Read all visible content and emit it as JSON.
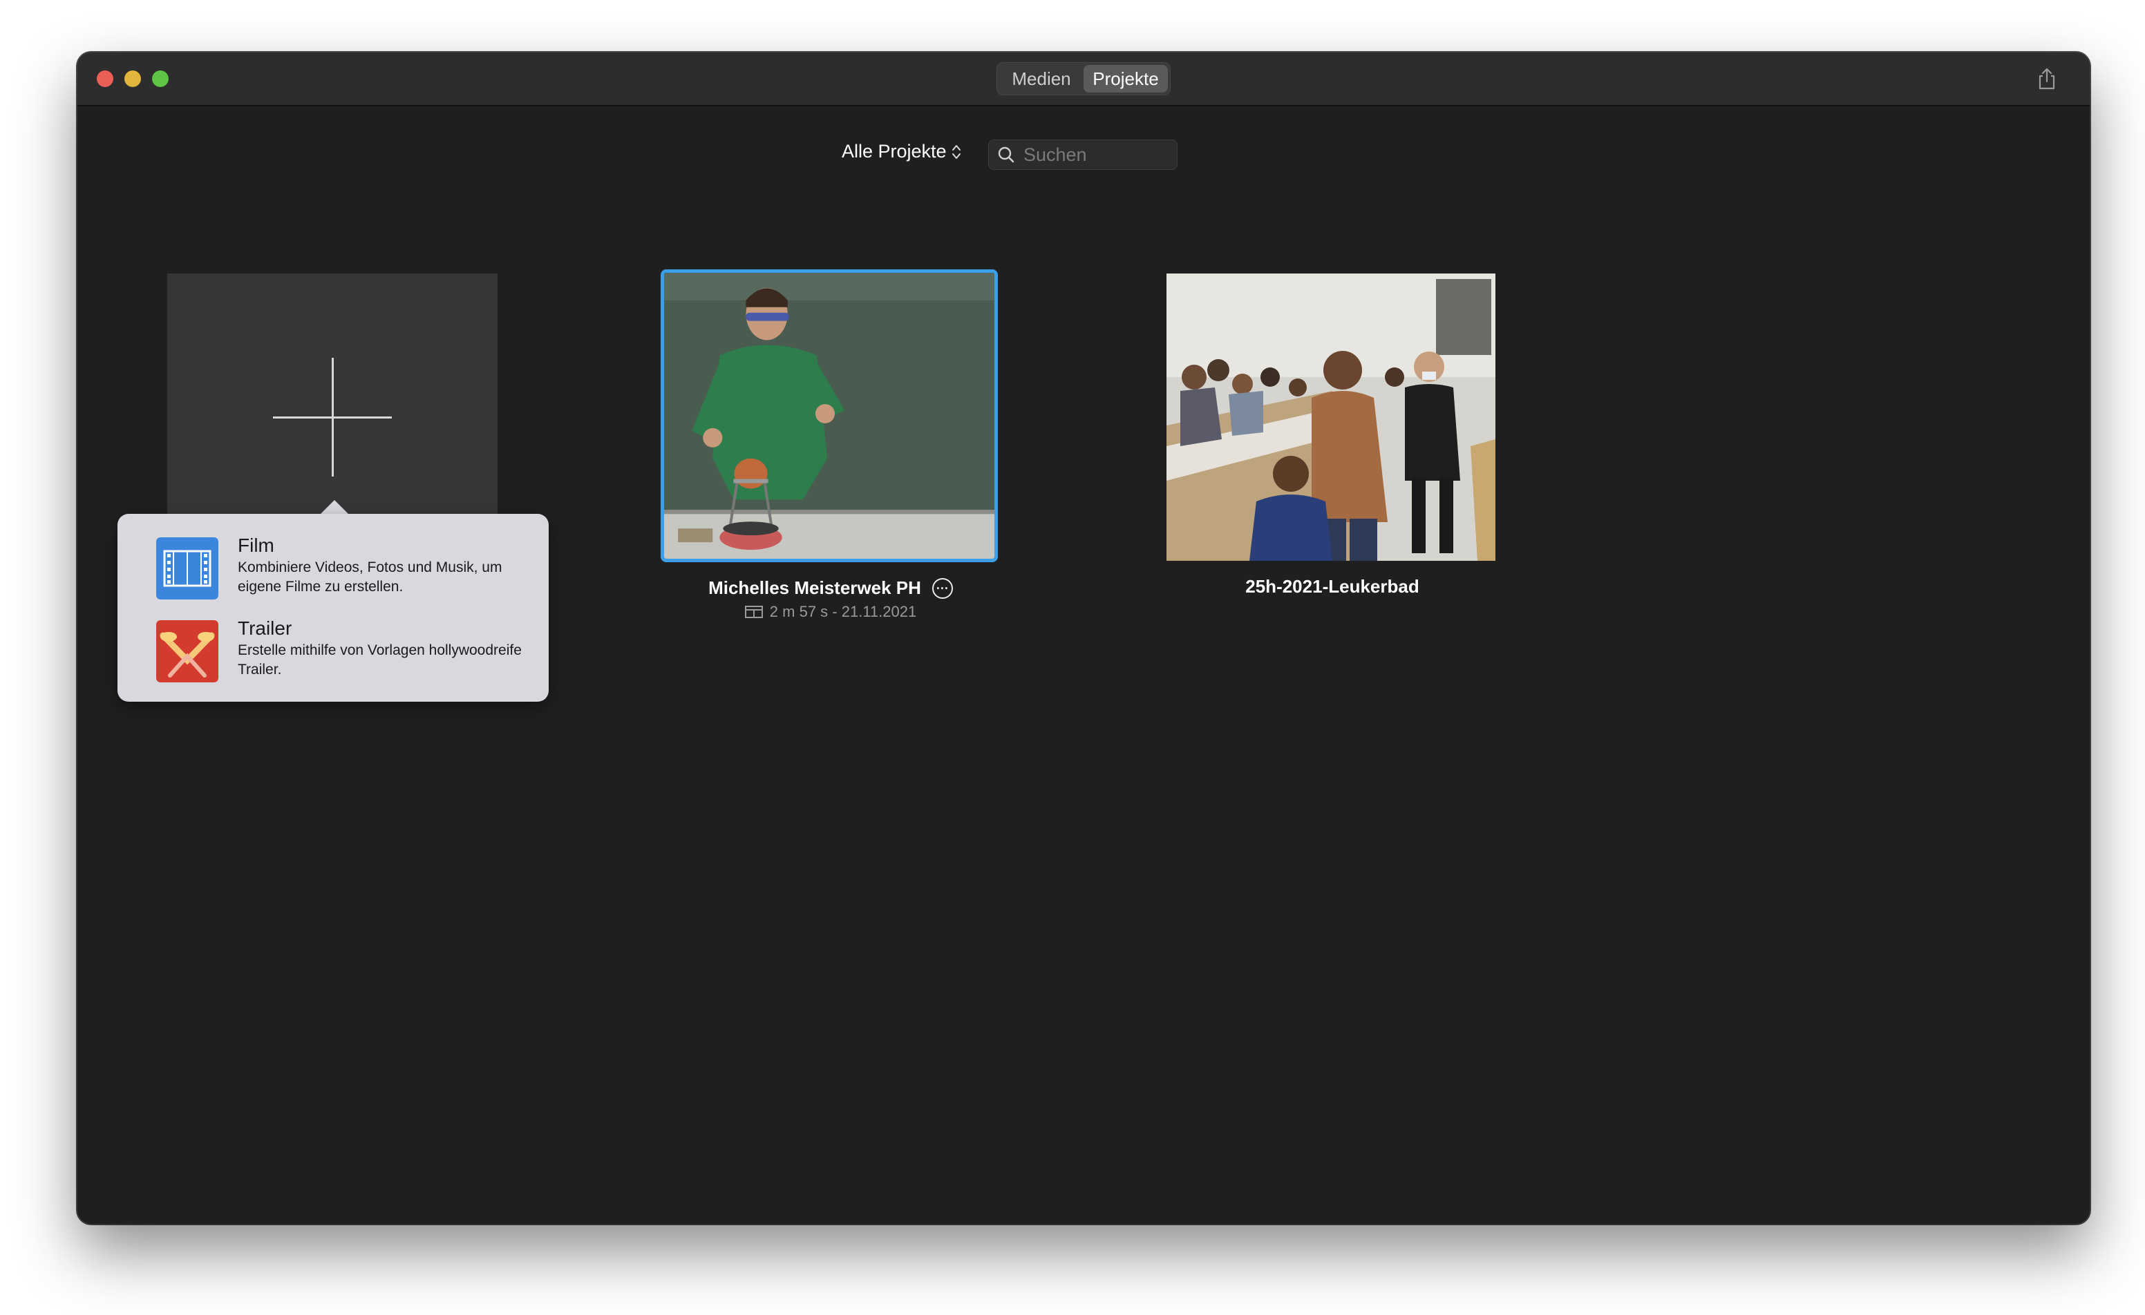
{
  "window": {
    "segments": [
      "Medien",
      "Projekte"
    ],
    "active_segment": "Projekte"
  },
  "filter": {
    "selected": "Alle Projekte",
    "search_placeholder": "Suchen"
  },
  "popover": {
    "items": [
      {
        "title": "Film",
        "description": "Kombiniere Videos, Fotos und Musik, um eigene Filme zu erstellen.",
        "icon": "film-icon"
      },
      {
        "title": "Trailer",
        "description": "Erstelle mithilfe von Vorlagen hollywoodreife Trailer.",
        "icon": "trailer-icon"
      }
    ]
  },
  "projects": [
    {
      "title": "Michelles Meisterwek PH",
      "meta": "2 m 57 s - 21.11.2021",
      "selected": true
    },
    {
      "title": "25h-2021-Leukerbad"
    }
  ],
  "colors": {
    "accent": "#3a9fe8",
    "window_bg": "#1f1f1f",
    "titlebar_bg": "#2d2d2d"
  }
}
